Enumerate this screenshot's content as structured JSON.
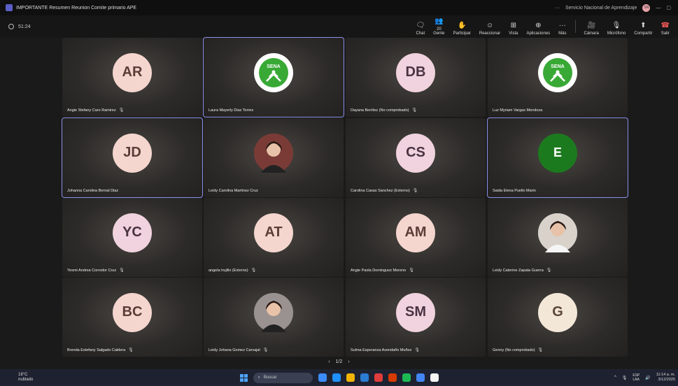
{
  "window": {
    "title": "IMPORTANTE Resumen Reunion Comite primario APE",
    "org": "Servicio Nacional de Aprendizaje",
    "org_avatar": "SN",
    "more": "···"
  },
  "toolbar": {
    "timer": "51:24",
    "tools": [
      {
        "key": "chat",
        "label": "Chat",
        "icon": "chat-icon",
        "glyph": "🗨"
      },
      {
        "key": "people",
        "label": "Gente",
        "icon": "people-icon",
        "glyph": "👥",
        "badge": "20"
      },
      {
        "key": "raise",
        "label": "Participar",
        "icon": "raise-hand-icon",
        "glyph": "✋"
      },
      {
        "key": "react",
        "label": "Reaccionar",
        "icon": "emoji-icon",
        "glyph": "☺"
      },
      {
        "key": "view",
        "label": "Vista",
        "icon": "grid-view-icon",
        "glyph": "⊞"
      },
      {
        "key": "apps",
        "label": "Aplicaciones",
        "icon": "apps-icon",
        "glyph": "⊕"
      },
      {
        "key": "more",
        "label": "Más",
        "icon": "more-icon",
        "glyph": "···"
      }
    ],
    "media": [
      {
        "key": "camera",
        "label": "Cámara",
        "icon": "camera-icon",
        "glyph": "🎥"
      },
      {
        "key": "mic",
        "label": "Micrófono",
        "icon": "mic-off-icon",
        "glyph": "🎙"
      },
      {
        "key": "share",
        "label": "Compartir",
        "icon": "share-icon",
        "glyph": "⬆"
      },
      {
        "key": "leave",
        "label": "Salir",
        "icon": "leave-call-icon",
        "glyph": "☎"
      }
    ]
  },
  "participants": [
    {
      "name": "Angie Stefany Caro Ramirez",
      "initials": "AR",
      "style": "light",
      "muted": true,
      "active": false
    },
    {
      "name": "Laura Mayerly Diaz Torres",
      "initials": "SENA",
      "style": "sena",
      "muted": false,
      "active": true
    },
    {
      "name": "Dayana Benítez (No comprobado)",
      "initials": "DB",
      "style": "pink",
      "muted": true,
      "active": false
    },
    {
      "name": "Luz Myriam Vargas Mendoza",
      "initials": "SENA",
      "style": "sena",
      "muted": false,
      "active": false
    },
    {
      "name": "Johanna Carolina Bernal Diaz",
      "initials": "JD",
      "style": "light",
      "muted": false,
      "active": true
    },
    {
      "name": "Leidy Carolina Martinez Cruz",
      "initials": "",
      "style": "photo",
      "muted": false,
      "active": false
    },
    {
      "name": "Carolina Casas Sanchez (Externo)",
      "initials": "CS",
      "style": "pink",
      "muted": true,
      "active": false
    },
    {
      "name": "Saida Elena Puello Marin",
      "initials": "E",
      "style": "green",
      "muted": false,
      "active": true
    },
    {
      "name": "Yesmi Andrea Corredor Cruz",
      "initials": "YC",
      "style": "pink",
      "muted": true,
      "active": false
    },
    {
      "name": "angela trujillo (Externo)",
      "initials": "AT",
      "style": "light",
      "muted": true,
      "active": false
    },
    {
      "name": "Angie Paola Dominguez Moreno",
      "initials": "AM",
      "style": "light",
      "muted": true,
      "active": false
    },
    {
      "name": "Leidy Caterine Zapata Guerra",
      "initials": "",
      "style": "photo2",
      "muted": true,
      "active": false
    },
    {
      "name": "Brenda Estefany Salgado Caldera",
      "initials": "BC",
      "style": "light",
      "muted": true,
      "active": false
    },
    {
      "name": "Leidy Johana Gomez Carvajal",
      "initials": "",
      "style": "photo3",
      "muted": true,
      "active": false
    },
    {
      "name": "Sulma Esperanza Avendaño Muñoz",
      "initials": "SM",
      "style": "pink",
      "muted": true,
      "active": false
    },
    {
      "name": "Genny (No comprobado)",
      "initials": "G",
      "style": "cream",
      "muted": true,
      "active": false
    }
  ],
  "pager": {
    "prev": "‹",
    "label": "1/2",
    "next": "›"
  },
  "taskbar": {
    "temp": "18°C",
    "weather": "nublado",
    "search": "Buscar",
    "lang": "ESP",
    "lang2": "LAA",
    "time": "11:14 a. m.",
    "date": "3/12/2025",
    "apps": [
      "#3c8cff",
      "#1e90ff",
      "#f0b400",
      "#2b7cd3",
      "#e03c3c",
      "#d83b01",
      "#1db954",
      "#4285f4",
      "#f5f5f5"
    ]
  }
}
